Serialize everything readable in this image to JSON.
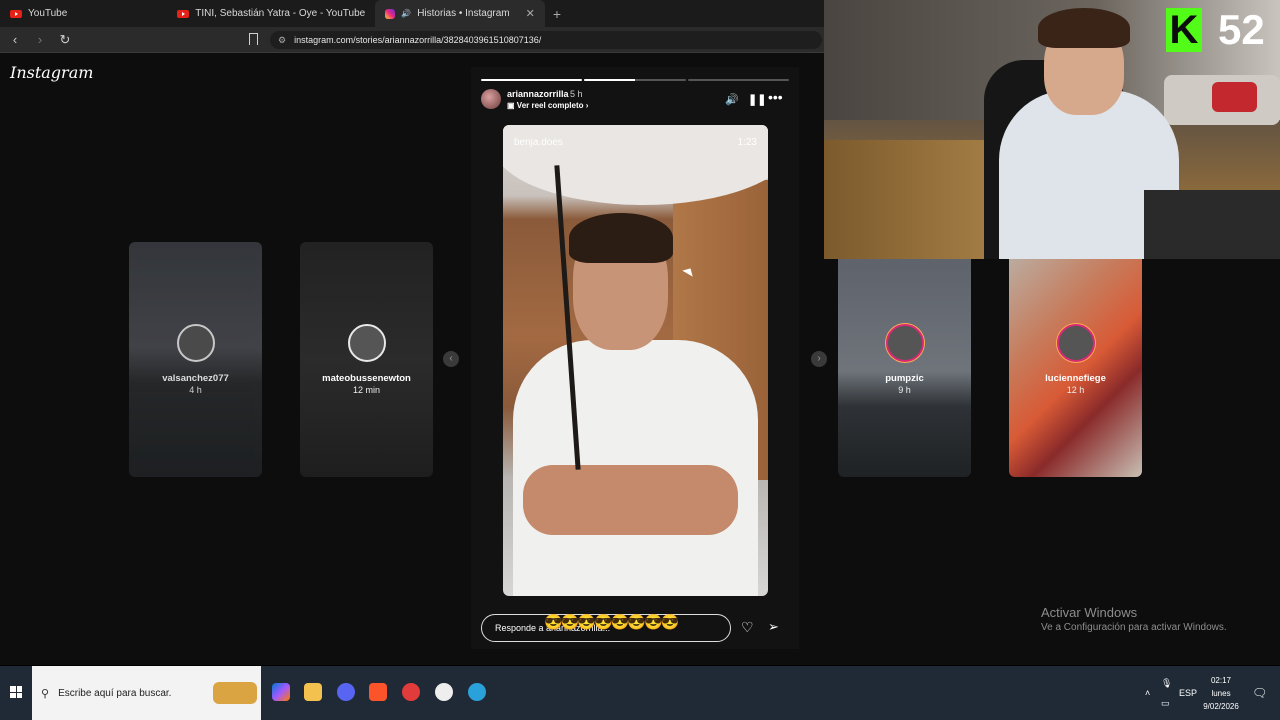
{
  "browser": {
    "tabs": [
      {
        "title": "YouTube",
        "icon": "youtube-icon"
      },
      {
        "title": "TINI, Sebastián Yatra - Oye - YouTube",
        "icon": "youtube-icon"
      },
      {
        "title": "Historias • Instagram",
        "icon": "instagram-icon",
        "active": true
      }
    ],
    "close_glyph": "✕",
    "newtab_glyph": "+",
    "url": "instagram.com/stories/ariannazorrilla/3828403961510807136/"
  },
  "instagram": {
    "logo": "Instagram",
    "side_stories": [
      {
        "username": "valsanchez077",
        "time": "4 h"
      },
      {
        "username": "mateobussenewton",
        "time": "12 min"
      },
      {
        "username": "pumpzic",
        "time": "9 h"
      },
      {
        "username": "luciennefiege",
        "time": "12 h"
      }
    ],
    "story": {
      "username": "ariannazorrilla",
      "time_ago": "5 h",
      "reel_link": "Ver reel completo",
      "source_label": "benja.does",
      "duration": "1:23",
      "progress": [
        1.0,
        0.5,
        0.0
      ],
      "reply_placeholder": "Responde a ariannazorrilla...",
      "emojis": "😎😎😎😎😎😎😎😎"
    }
  },
  "stream_overlay": {
    "platform_letter": "K",
    "viewer_count": "52",
    "kick_color": "#53fc18"
  },
  "windows": {
    "activate_title": "Activar Windows",
    "activate_subtitle": "Ve a Configuración para activar Windows.",
    "search_placeholder": "Escribe aquí para buscar.",
    "language": "ESP",
    "time": "02:17",
    "day": "lunes",
    "date": "9/02/2026"
  }
}
